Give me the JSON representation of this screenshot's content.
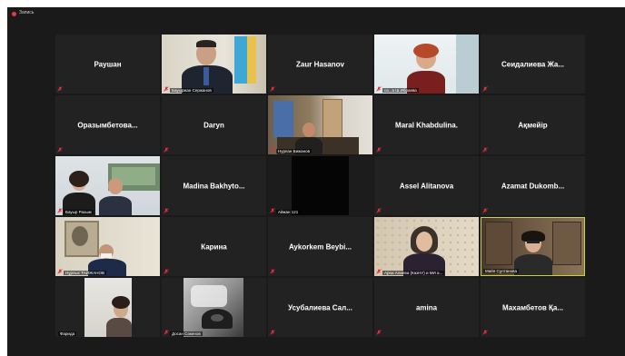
{
  "window": {
    "recording_label": "Запись"
  },
  "colors": {
    "muted": "#e0303a",
    "active_border": "#c8d43a",
    "tile_bg": "#222222"
  },
  "tiles": [
    {
      "name": "Раушан",
      "type": "name",
      "muted": true
    },
    {
      "name": "Бауыржан Сержанов",
      "type": "video",
      "muted": true
    },
    {
      "name": "Zaur Hasanov",
      "type": "name",
      "muted": true
    },
    {
      "name": "са...а Ш.Ибраева",
      "type": "video",
      "muted": true
    },
    {
      "name": "Сеидалиева Жа...",
      "type": "name",
      "muted": true
    },
    {
      "name": "Оразымбетова...",
      "type": "name",
      "muted": true
    },
    {
      "name": "Daryn",
      "type": "name",
      "muted": true
    },
    {
      "name": "Нурлан Бижанов",
      "type": "video",
      "muted": true
    },
    {
      "name": "Maral Khabdulina.",
      "type": "name",
      "muted": true
    },
    {
      "name": "Ақмейір",
      "type": "name",
      "muted": true
    },
    {
      "name": "Бауыр Рахым",
      "type": "video",
      "muted": true
    },
    {
      "name": "Madina Bakhyto...",
      "type": "name",
      "muted": true
    },
    {
      "name": "Айжан 121",
      "type": "video",
      "muted": true
    },
    {
      "name": "Assel Alitanova",
      "type": "name",
      "muted": true
    },
    {
      "name": "Azamat Dukomb...",
      "type": "name",
      "muted": true
    },
    {
      "name": "Нұрлыс ТАЙЖАНОВ",
      "type": "video",
      "muted": true
    },
    {
      "name": "Карина",
      "type": "name",
      "muted": true
    },
    {
      "name": "Aykorkem Beybi...",
      "type": "name",
      "muted": true
    },
    {
      "name": "Арна Алиева (КазНУ) и МИ а...",
      "type": "video",
      "muted": true
    },
    {
      "name": "Майя Сұлтанова",
      "type": "video",
      "muted": false,
      "active": true
    },
    {
      "name": "Фарида",
      "type": "video",
      "muted": false
    },
    {
      "name": "Досан Сәкенов",
      "type": "video",
      "muted": true
    },
    {
      "name": "Усубалиева Сал...",
      "type": "name",
      "muted": true
    },
    {
      "name": "amina",
      "type": "name",
      "muted": true
    },
    {
      "name": "Махамбетов Қа...",
      "type": "name",
      "muted": true
    }
  ]
}
